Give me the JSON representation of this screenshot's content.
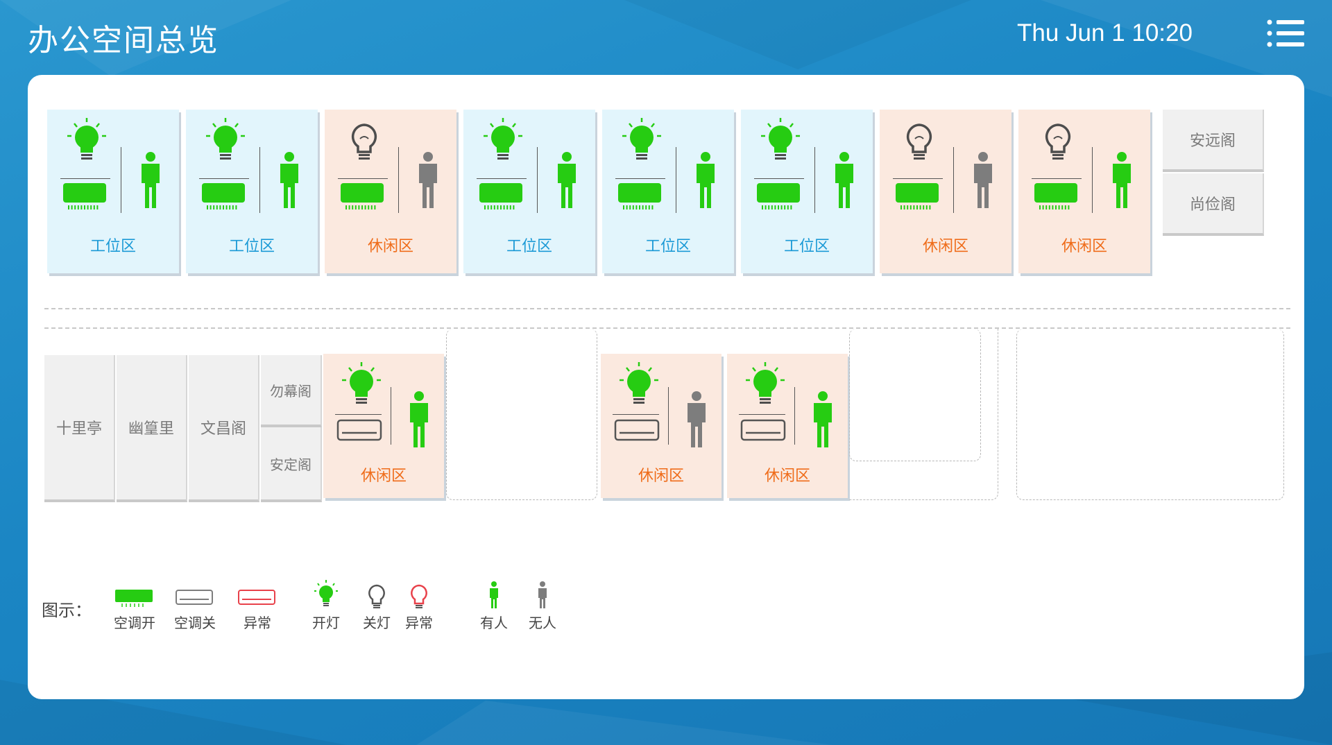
{
  "header": {
    "title": "办公空间总览",
    "datetime": "Thu Jun 1 10:20",
    "menu_icon": "list-menu-icon"
  },
  "colors": {
    "on": "#26cc12",
    "off": "#7d7d7d",
    "alarm": "#e8414a",
    "work_bg": "#e2f5fc",
    "leisure_bg": "#fbe9df",
    "work_text": "#1c9ad6",
    "leisure_text": "#ef6c1a"
  },
  "top_row": {
    "zones": [
      {
        "label": "工位区",
        "type": "work",
        "light": "on",
        "ac": "on",
        "person": "present"
      },
      {
        "label": "工位区",
        "type": "work",
        "light": "on",
        "ac": "on",
        "person": "present"
      },
      {
        "label": "休闲区",
        "type": "leisure",
        "light": "off",
        "ac": "on",
        "person": "absent"
      },
      {
        "label": "工位区",
        "type": "work",
        "light": "on",
        "ac": "on",
        "person": "present"
      },
      {
        "label": "工位区",
        "type": "work",
        "light": "on",
        "ac": "on",
        "person": "present"
      },
      {
        "label": "工位区",
        "type": "work",
        "light": "on",
        "ac": "on",
        "person": "present"
      },
      {
        "label": "休闲区",
        "type": "leisure",
        "light": "off",
        "ac": "on",
        "person": "absent"
      },
      {
        "label": "休闲区",
        "type": "leisure",
        "light": "off",
        "ac": "on",
        "person": "present"
      }
    ],
    "rooms": [
      "安远阁",
      "尚俭阁"
    ]
  },
  "bottom_row": {
    "rooms": [
      "十里亭",
      "幽篁里",
      "文昌阁"
    ],
    "small_rooms": [
      "勿幕阁",
      "安定阁"
    ],
    "zones": [
      {
        "label": "休闲区",
        "type": "leisure",
        "light": "on",
        "ac": "off",
        "person": "present"
      },
      {
        "label": "休闲区",
        "type": "leisure",
        "light": "on",
        "ac": "off",
        "person": "absent"
      },
      {
        "label": "休闲区",
        "type": "leisure",
        "light": "on",
        "ac": "off",
        "person": "present"
      }
    ]
  },
  "legend": {
    "title": "图示：",
    "items": [
      {
        "label": "空调开",
        "icon": "ac-on-icon"
      },
      {
        "label": "空调关",
        "icon": "ac-off-icon"
      },
      {
        "label": "异常",
        "icon": "ac-alarm-icon"
      },
      {
        "label": "开灯",
        "icon": "light-on-icon"
      },
      {
        "label": "关灯",
        "icon": "light-off-icon"
      },
      {
        "label": "异常",
        "icon": "light-alarm-icon"
      },
      {
        "label": "有人",
        "icon": "person-present-icon"
      },
      {
        "label": "无人",
        "icon": "person-absent-icon"
      }
    ]
  }
}
